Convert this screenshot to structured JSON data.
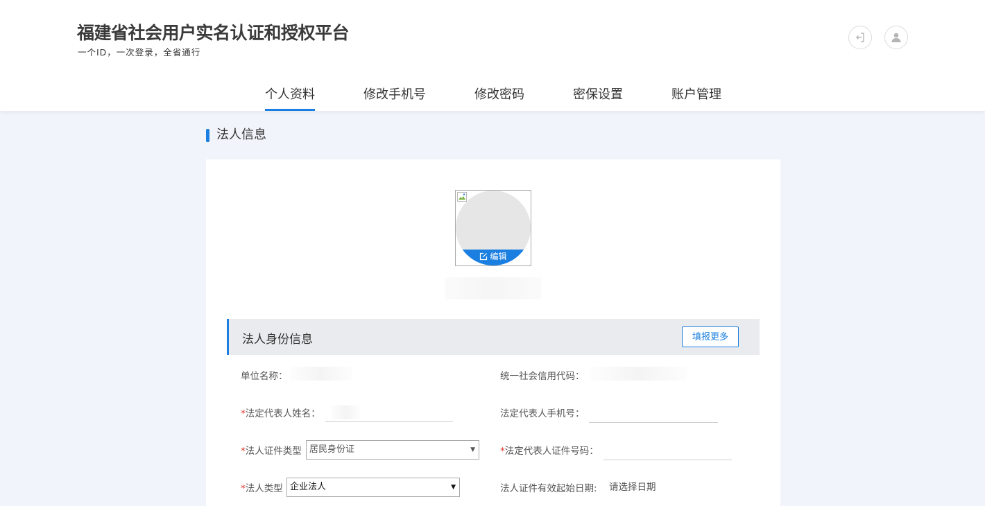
{
  "header": {
    "title": "福建省社会用户实名认证和授权平台",
    "subtitle": "一个ID，一次登录，全省通行",
    "logout_icon": "logout-icon",
    "user_icon": "user-icon"
  },
  "nav": {
    "items": [
      {
        "label": "个人资料",
        "active": true
      },
      {
        "label": "修改手机号",
        "active": false
      },
      {
        "label": "修改密码",
        "active": false
      },
      {
        "label": "密保设置",
        "active": false
      },
      {
        "label": "账户管理",
        "active": false
      }
    ]
  },
  "section": {
    "title": "法人信息"
  },
  "avatar": {
    "edit_label": "编辑"
  },
  "panel": {
    "title": "法人身份信息",
    "more_label": "填报更多"
  },
  "form": {
    "unit_name_label": "单位名称：",
    "credit_code_label": "统一社会信用代码：",
    "rep_name_label": "法定代表人姓名：",
    "rep_phone_label": "法定代表人手机号：",
    "cert_type_label": "法人证件类型",
    "cert_type_value": "居民身份证",
    "cert_no_label": "法定代表人证件号码：",
    "legal_type_label": "法人类型",
    "legal_type_value": "企业法人",
    "cert_start_label": "法人证件有效起始日期:",
    "cert_start_placeholder": "请选择日期",
    "required_mark": "*"
  },
  "colors": {
    "accent": "#1a7fe0",
    "required": "#e5352d",
    "page_bg": "#f1f5fb",
    "panel_bg": "#eaebee"
  }
}
